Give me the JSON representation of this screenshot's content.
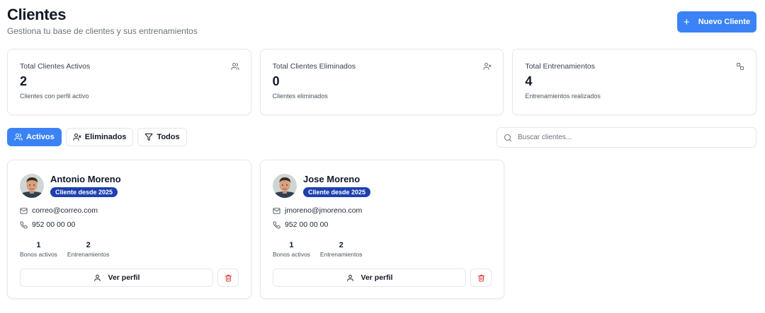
{
  "header": {
    "title": "Clientes",
    "subtitle": "Gestiona tu base de clientes y sus entrenamientos",
    "new_client_label": "Nuevo Cliente",
    "new_client_icon": "plus-icon"
  },
  "stats": [
    {
      "label": "Total Clientes Activos",
      "value": "2",
      "desc": "Clientes con perfil activo",
      "icon": "users-icon"
    },
    {
      "label": "Total Clientes Eliminados",
      "value": "0",
      "desc": "Clientes eliminados",
      "icon": "user-x-icon"
    },
    {
      "label": "Total Entrenamientos",
      "value": "4",
      "desc": "Entrenamientos realizados",
      "icon": "dumbbell-icon"
    }
  ],
  "filters": {
    "active": "Activos",
    "deleted": "Eliminados",
    "all": "Todos",
    "selected": "Activos"
  },
  "search": {
    "placeholder": "Buscar clientes...",
    "value": ""
  },
  "clients": [
    {
      "name": "Antonio Moreno",
      "badge": "Cliente desde 2025",
      "email": "correo@correo.com",
      "phone": "952 00 00 00",
      "bonos": "1",
      "bonos_label": "Bonos activos",
      "trainings": "2",
      "trainings_label": "Entrenamientos",
      "profile_label": "Ver perfil"
    },
    {
      "name": "Jose Moreno",
      "badge": "Cliente desde 2025",
      "email": "jmoreno@jmoreno.com",
      "phone": "952 00 00 00",
      "bonos": "1",
      "bonos_label": "Bonos activos",
      "trainings": "2",
      "trainings_label": "Entrenamientos",
      "profile_label": "Ver perfil"
    }
  ],
  "colors": {
    "primary": "#3b82f6",
    "badge": "#1e40af",
    "danger": "#dc2626",
    "border": "#e5e7eb"
  }
}
